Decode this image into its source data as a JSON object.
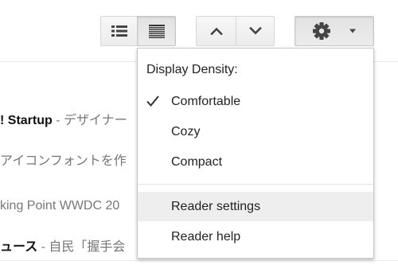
{
  "toolbar": {
    "view_list_icon": "list-view-icon",
    "view_expanded_icon": "expanded-view-icon",
    "nav_up_icon": "chevron-up-icon",
    "nav_down_icon": "chevron-down-icon",
    "settings_icon": "gear-icon",
    "settings_caret_icon": "caret-down-icon"
  },
  "articles": [
    {
      "title": "! Startup",
      "snippet": " - デザイナー"
    },
    {
      "title": "",
      "snippet": "アイコンフォントを作"
    },
    {
      "title": "",
      "snippet": "king Point WWDC 20"
    },
    {
      "title": "ュース",
      "snippet": " - 自民「握手会"
    }
  ],
  "menu": {
    "heading": "Display Density:",
    "items": [
      {
        "label": "Comfortable",
        "checked": true
      },
      {
        "label": "Cozy",
        "checked": false
      },
      {
        "label": "Compact",
        "checked": false
      }
    ],
    "settings": [
      {
        "label": "Reader settings",
        "highlighted": true
      },
      {
        "label": "Reader help",
        "highlighted": false
      }
    ]
  },
  "colors": {
    "button_bg": "#f1f1f1",
    "button_border": "#d6d6d6",
    "icon": "#444444",
    "menu_hover": "#eeeeee"
  }
}
